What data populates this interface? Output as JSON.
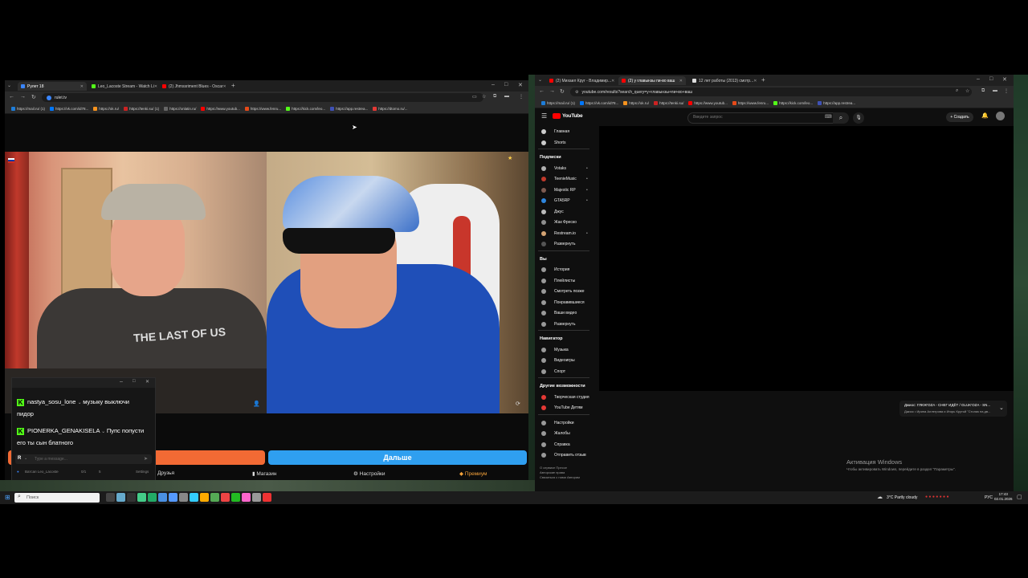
{
  "left_browser": {
    "tabs": [
      {
        "label": "Рулет 18",
        "color": "#3a86ff",
        "active": true
      },
      {
        "label": "Leo_Lacoste Stream - Watch Li",
        "color": "#53fc18",
        "active": false
      },
      {
        "label": "(2) Jhmssriment Blues - Oscar",
        "color": "#ff0000",
        "active": false
      }
    ],
    "url": "rulet.tv",
    "bookmarks": [
      {
        "label": "https://mail.ru/ (1)",
        "color": "#1e7dd8"
      },
      {
        "label": "https://vk.com/id78...",
        "color": "#0077ff"
      },
      {
        "label": "https://ok.ru/",
        "color": "#f7931e"
      },
      {
        "label": "https://tenki.su/ (1)",
        "color": "#cc2222"
      },
      {
        "label": "https://onlatin.ru/",
        "color": "#666666"
      },
      {
        "label": "https://www.youtub...",
        "color": "#ff0000"
      },
      {
        "label": "https://www.fenru...",
        "color": "#e64a19"
      },
      {
        "label": "https://kick.com/leo...",
        "color": "#53fc18"
      },
      {
        "label": "https://app.restrea...",
        "color": "#3f51b5"
      },
      {
        "label": "https://dtomo.ru/...",
        "color": "#e53935"
      }
    ]
  },
  "chat": {
    "messages": [
      {
        "user": "nastya_sosu_lone",
        "text": "музыку выключи",
        "text2": "пидор"
      },
      {
        "user": "PIONERKA_GENAKISELA",
        "text": "Пупс попусти",
        "text2": "его ты сын блатного"
      }
    ],
    "input_placeholder": "Type a message...",
    "footer_user": "Ватсап Leo_Lacoste",
    "footer_counts": [
      "0/1",
      "5"
    ],
    "footer_settings": "Settings",
    "footer_avatar_letter": "R"
  },
  "video_controls": {
    "next_button": "Дальше",
    "menu": [
      "Друзья",
      "Магазин",
      "Настройки",
      "Премиум"
    ]
  },
  "right_browser": {
    "tabs": [
      {
        "label": "(2) Михаил Круг - Владимир...",
        "color": "#ff0000",
        "active": false
      },
      {
        "label": "(2) у главынзы пи-во ваш",
        "color": "#ff0000",
        "active": true
      },
      {
        "label": "12 лет работы (2013) смотр...",
        "color": "#dddddd",
        "active": false
      }
    ],
    "url": "youtube.com/results?search_query=у+главынзы+пи+во+ваш",
    "bookmarks": [
      {
        "label": "https://mail.ru/ (1)",
        "color": "#1e7dd8"
      },
      {
        "label": "https://vk.com/id78...",
        "color": "#0077ff"
      },
      {
        "label": "https://ok.ru/",
        "color": "#f7931e"
      },
      {
        "label": "https://tenki.su/",
        "color": "#cc2222"
      },
      {
        "label": "https://www.youtub...",
        "color": "#ff0000"
      },
      {
        "label": "https://www.fenru...",
        "color": "#e64a19"
      },
      {
        "label": "https://kick.com/leo...",
        "color": "#53fc18"
      },
      {
        "label": "https://app.restrea...",
        "color": "#3f51b5"
      }
    ]
  },
  "youtube": {
    "logo": "YouTube",
    "search_placeholder": "Введите запрос",
    "create_label": "+ Создать",
    "sidebar": {
      "top": [
        "Главная",
        "Shorts"
      ],
      "subs_header": "Подписки",
      "subs": [
        "Votaks",
        "TeenieMusic",
        "Majestic RP",
        "GTA5RP",
        "Джус",
        "Жак Фреско",
        "Restream.io"
      ],
      "subs_expand": "Развернуть",
      "you_header": "Вы",
      "you": [
        "История",
        "Плейлисты",
        "Смотреть позже",
        "Понравившиеся",
        "Ваши видео",
        "Развернуть"
      ],
      "nav_header": "Навигатор",
      "nav": [
        "Музыка",
        "Видеоигры",
        "Спорт"
      ],
      "more_header": "Другие возможности",
      "more": [
        "Творческая студия",
        "YouTube Детям"
      ],
      "settings": [
        "Настройки",
        "Жалобы",
        "Справка",
        "Отправить отзыв"
      ],
      "footer1": "О сервисе  Прессе",
      "footer2": "Авторские права",
      "footer3": "Связаться с нами  Авторам"
    },
    "mini_player": {
      "title": "Джиос: ГЛЮК'OZA - СНЕГ ИДЁТ / GLUK'OZA - SN...",
      "subtitle": "Джиос • Ирина Аллегрова и Игорь Крутой \"Столик на дв..."
    },
    "watermark_title": "Активация Windows",
    "watermark_sub": "Чтобы активировать Windows, перейдите в раздел \"Параметры\"."
  },
  "taskbar": {
    "search_placeholder": "Поиск",
    "weather": "3°C  Partly cloudy",
    "lang": "РУС",
    "time": "17:43",
    "date": "02.01.2026"
  }
}
